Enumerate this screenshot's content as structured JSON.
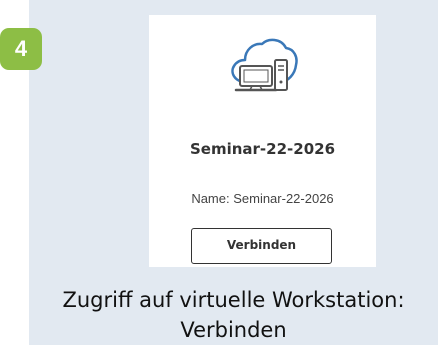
{
  "step": {
    "number": "4",
    "badge_color": "#8dbe45"
  },
  "card": {
    "icon": "cloud-computer-icon",
    "icon_color": "#3a78b8",
    "title": "Seminar-22-2026",
    "name_line": "Name: Seminar-22-2026",
    "connect_label": "Verbinden"
  },
  "caption": {
    "line1": "Zugriff auf virtuelle Workstation:",
    "line2": "Verbinden"
  },
  "colors": {
    "panel_background": "#e2e9f1",
    "card_background": "#ffffff"
  }
}
